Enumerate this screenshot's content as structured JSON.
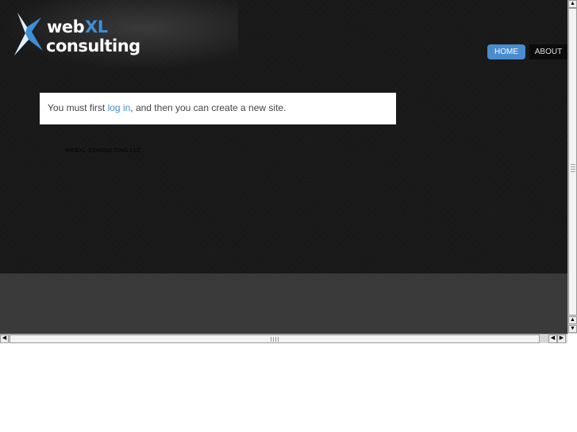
{
  "header": {
    "logo": {
      "word_web": "web",
      "word_xl": "XL",
      "word_consulting": "consulting"
    }
  },
  "nav": {
    "items": [
      {
        "label": "HOME",
        "active": true
      },
      {
        "label": "ABOUT",
        "active": false
      }
    ]
  },
  "notice": {
    "prefix": "You must first ",
    "link": "log in",
    "suffix": ", and then you can create a new site."
  },
  "footer": {
    "copyright": "WEBXL CONSULTING LLC"
  },
  "colors": {
    "accent": "#4a8cd0",
    "background": "#1a1a1a",
    "footer_band": "#3a3a3a"
  },
  "scrollbars": {
    "up_arrow": "▲",
    "down_arrow": "▼",
    "left_arrow": "◀",
    "right_arrow": "▶"
  }
}
